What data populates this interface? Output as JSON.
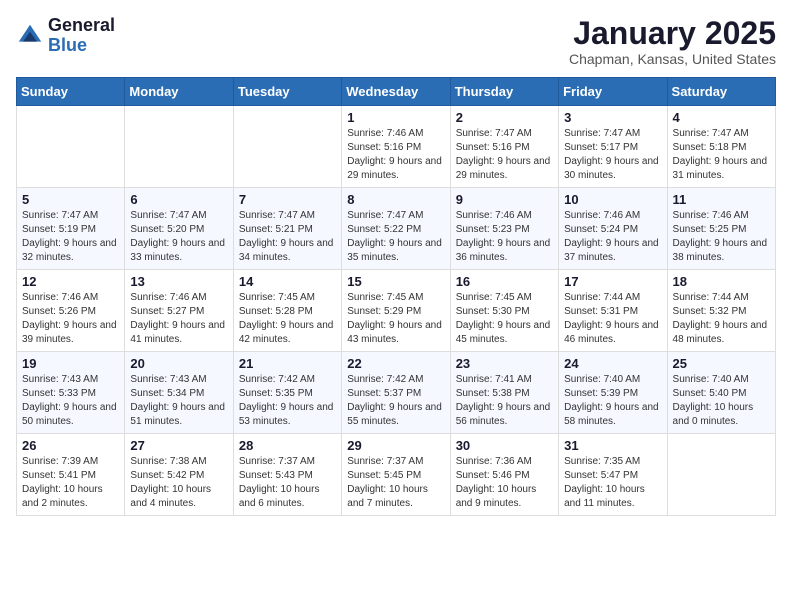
{
  "logo": {
    "general": "General",
    "blue": "Blue"
  },
  "title": "January 2025",
  "location": "Chapman, Kansas, United States",
  "days_of_week": [
    "Sunday",
    "Monday",
    "Tuesday",
    "Wednesday",
    "Thursday",
    "Friday",
    "Saturday"
  ],
  "weeks": [
    [
      {
        "day": "",
        "info": ""
      },
      {
        "day": "",
        "info": ""
      },
      {
        "day": "",
        "info": ""
      },
      {
        "day": "1",
        "info": "Sunrise: 7:46 AM\nSunset: 5:16 PM\nDaylight: 9 hours and 29 minutes."
      },
      {
        "day": "2",
        "info": "Sunrise: 7:47 AM\nSunset: 5:16 PM\nDaylight: 9 hours and 29 minutes."
      },
      {
        "day": "3",
        "info": "Sunrise: 7:47 AM\nSunset: 5:17 PM\nDaylight: 9 hours and 30 minutes."
      },
      {
        "day": "4",
        "info": "Sunrise: 7:47 AM\nSunset: 5:18 PM\nDaylight: 9 hours and 31 minutes."
      }
    ],
    [
      {
        "day": "5",
        "info": "Sunrise: 7:47 AM\nSunset: 5:19 PM\nDaylight: 9 hours and 32 minutes."
      },
      {
        "day": "6",
        "info": "Sunrise: 7:47 AM\nSunset: 5:20 PM\nDaylight: 9 hours and 33 minutes."
      },
      {
        "day": "7",
        "info": "Sunrise: 7:47 AM\nSunset: 5:21 PM\nDaylight: 9 hours and 34 minutes."
      },
      {
        "day": "8",
        "info": "Sunrise: 7:47 AM\nSunset: 5:22 PM\nDaylight: 9 hours and 35 minutes."
      },
      {
        "day": "9",
        "info": "Sunrise: 7:46 AM\nSunset: 5:23 PM\nDaylight: 9 hours and 36 minutes."
      },
      {
        "day": "10",
        "info": "Sunrise: 7:46 AM\nSunset: 5:24 PM\nDaylight: 9 hours and 37 minutes."
      },
      {
        "day": "11",
        "info": "Sunrise: 7:46 AM\nSunset: 5:25 PM\nDaylight: 9 hours and 38 minutes."
      }
    ],
    [
      {
        "day": "12",
        "info": "Sunrise: 7:46 AM\nSunset: 5:26 PM\nDaylight: 9 hours and 39 minutes."
      },
      {
        "day": "13",
        "info": "Sunrise: 7:46 AM\nSunset: 5:27 PM\nDaylight: 9 hours and 41 minutes."
      },
      {
        "day": "14",
        "info": "Sunrise: 7:45 AM\nSunset: 5:28 PM\nDaylight: 9 hours and 42 minutes."
      },
      {
        "day": "15",
        "info": "Sunrise: 7:45 AM\nSunset: 5:29 PM\nDaylight: 9 hours and 43 minutes."
      },
      {
        "day": "16",
        "info": "Sunrise: 7:45 AM\nSunset: 5:30 PM\nDaylight: 9 hours and 45 minutes."
      },
      {
        "day": "17",
        "info": "Sunrise: 7:44 AM\nSunset: 5:31 PM\nDaylight: 9 hours and 46 minutes."
      },
      {
        "day": "18",
        "info": "Sunrise: 7:44 AM\nSunset: 5:32 PM\nDaylight: 9 hours and 48 minutes."
      }
    ],
    [
      {
        "day": "19",
        "info": "Sunrise: 7:43 AM\nSunset: 5:33 PM\nDaylight: 9 hours and 50 minutes."
      },
      {
        "day": "20",
        "info": "Sunrise: 7:43 AM\nSunset: 5:34 PM\nDaylight: 9 hours and 51 minutes."
      },
      {
        "day": "21",
        "info": "Sunrise: 7:42 AM\nSunset: 5:35 PM\nDaylight: 9 hours and 53 minutes."
      },
      {
        "day": "22",
        "info": "Sunrise: 7:42 AM\nSunset: 5:37 PM\nDaylight: 9 hours and 55 minutes."
      },
      {
        "day": "23",
        "info": "Sunrise: 7:41 AM\nSunset: 5:38 PM\nDaylight: 9 hours and 56 minutes."
      },
      {
        "day": "24",
        "info": "Sunrise: 7:40 AM\nSunset: 5:39 PM\nDaylight: 9 hours and 58 minutes."
      },
      {
        "day": "25",
        "info": "Sunrise: 7:40 AM\nSunset: 5:40 PM\nDaylight: 10 hours and 0 minutes."
      }
    ],
    [
      {
        "day": "26",
        "info": "Sunrise: 7:39 AM\nSunset: 5:41 PM\nDaylight: 10 hours and 2 minutes."
      },
      {
        "day": "27",
        "info": "Sunrise: 7:38 AM\nSunset: 5:42 PM\nDaylight: 10 hours and 4 minutes."
      },
      {
        "day": "28",
        "info": "Sunrise: 7:37 AM\nSunset: 5:43 PM\nDaylight: 10 hours and 6 minutes."
      },
      {
        "day": "29",
        "info": "Sunrise: 7:37 AM\nSunset: 5:45 PM\nDaylight: 10 hours and 7 minutes."
      },
      {
        "day": "30",
        "info": "Sunrise: 7:36 AM\nSunset: 5:46 PM\nDaylight: 10 hours and 9 minutes."
      },
      {
        "day": "31",
        "info": "Sunrise: 7:35 AM\nSunset: 5:47 PM\nDaylight: 10 hours and 11 minutes."
      },
      {
        "day": "",
        "info": ""
      }
    ]
  ]
}
